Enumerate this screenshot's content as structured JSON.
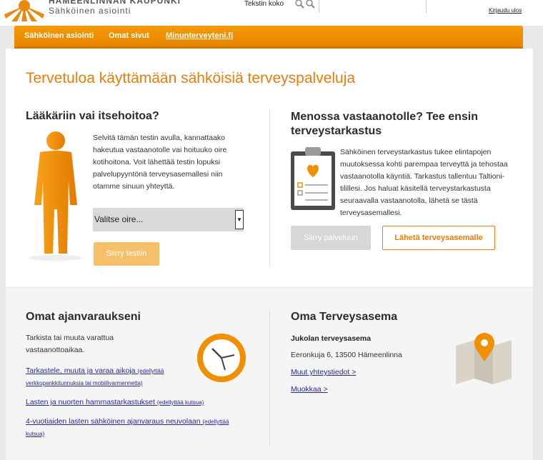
{
  "header": {
    "brand_line1": "HÄMEENLINNAN KAUPUNKI",
    "brand_line2": "Sähköinen asiointi",
    "text_size_label": "Tekstin koko",
    "logout": "Kirjaudu ulos"
  },
  "nav": {
    "items": [
      "Sähköinen asiointi",
      "Omat sivut",
      "Minunterveyteni.fi"
    ]
  },
  "main": {
    "title": "Tervetuloa käyttämään sähköisiä terveyspalveluja",
    "left": {
      "heading": "Lääkäriin vai itsehoitoa?",
      "text": "Selvitä tämän testin avulla, kannattaako hakeutua vastaanotolle vai hoituuko oire kotihoitona. Voit lähettää testin lopuksi palvelupyyntönä terveysasemallesi niin otamme sinuun yhteyttä.",
      "select_value": "Valitse oire...",
      "button": "Siirry testiin"
    },
    "right": {
      "heading_line1": "Menossa vastaanotolle? Tee ensin",
      "heading_line2": "terveystarkastus",
      "text": "Sähköinen terveystarkastus tukee elintapojen muutoksessa kohti parempaa terveyttä ja tehostaa vastaanotolla käyntiä. Tarkastus tallentuu Taltioni-tilillesi. Jos haluat käsitellä terveystarkastusta seuraavalla vastaanotolla, lähetä se tästä terveysasemallesi.",
      "button_gray": "Siirry palveluun",
      "button_send": "Lähetä terveysasemalle"
    }
  },
  "appointments": {
    "heading": "Omat ajanvaraukseni",
    "text": "Tarkista tai muuta varattua vastaanottoaikaa.",
    "links": [
      {
        "main": "Tarkastele, muuta ja varaa aikoja",
        "note": "(edellyttää verkkopankkitunnuksia tai mobiilivarmennetta)"
      },
      {
        "main": "Lasten ja nuorten hammastarkastukset",
        "note": "(edellyttää kutsua)"
      },
      {
        "main": "4-vuotiaiden lasten sähköinen ajanvaraus neuvolaan",
        "note": "(edellyttää kutsua)"
      }
    ]
  },
  "station": {
    "heading": "Oma Terveysasema",
    "name": "Jukolan terveysasema",
    "address": "Eeronkuja 6, 13500 Hämeenlinna",
    "link_more": "Muut yhteystiedot >",
    "link_edit": "Muokkaa >"
  },
  "colors": {
    "accent": "#e87d0d",
    "nav": "#f08f00"
  }
}
